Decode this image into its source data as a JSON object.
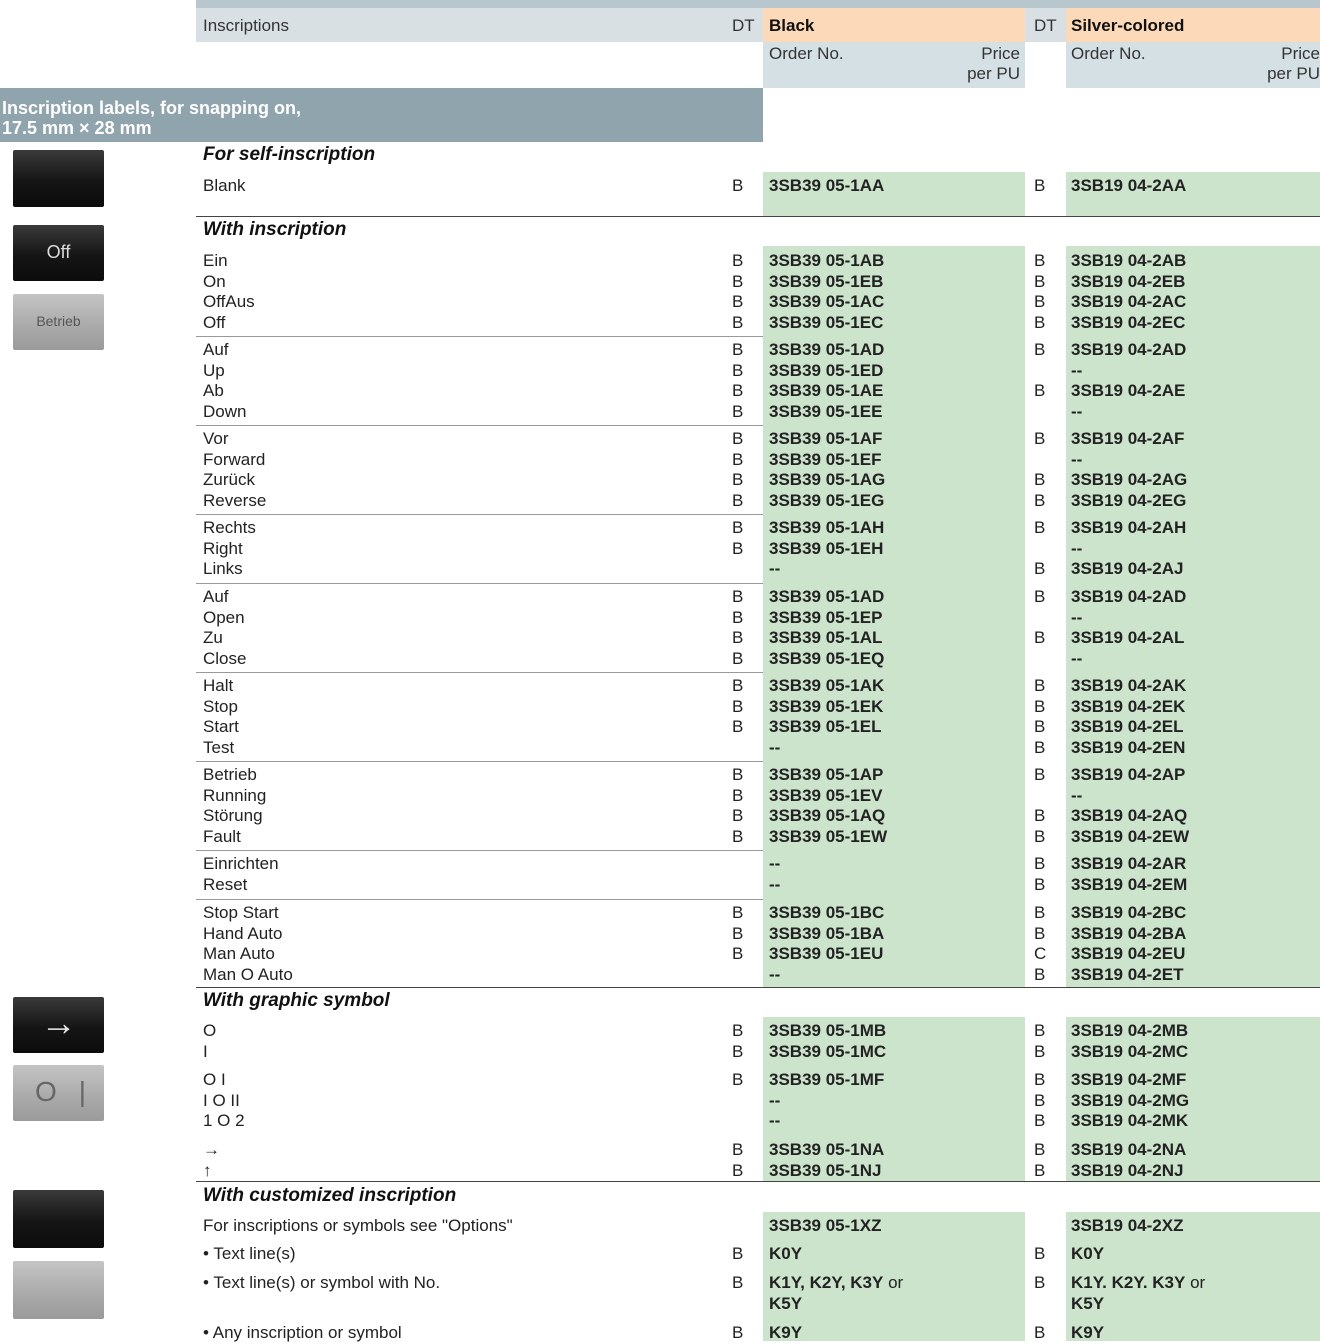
{
  "header": {
    "inscriptions": "Inscriptions",
    "dt": "DT",
    "black": "Black",
    "silver": "Silver-colored",
    "order_no": "Order No.",
    "price": "Price",
    "per_pu": "per PU"
  },
  "section": {
    "line1": "Inscription labels, for snapping on,",
    "line2": "17.5 mm × 28 mm"
  },
  "thumbs": {
    "off": "Off",
    "betrieb": "Betrieb",
    "arrow": "→",
    "o": "O",
    "i": "|"
  },
  "groups": [
    {
      "title": "For self-inscription",
      "rows": [
        {
          "label": "Blank",
          "dt1": "B",
          "black": "3SB39 05-1AA",
          "dt2": "B",
          "silver": "3SB19 04-2AA"
        }
      ]
    },
    {
      "title": "With inscription",
      "rows": [
        {
          "label": "Ein",
          "dt1": "B",
          "black": "3SB39 05-1AB",
          "dt2": "B",
          "silver": "3SB19 04-2AB"
        },
        {
          "label": "On",
          "dt1": "B",
          "black": "3SB39 05-1EB",
          "dt2": "B",
          "silver": "3SB19 04-2EB"
        },
        {
          "label": "OffAus",
          "dt1": "B",
          "black": "3SB39 05-1AC",
          "dt2": "B",
          "silver": "3SB19 04-2AC"
        },
        {
          "label": "Off",
          "dt1": "B",
          "black": "3SB39 05-1EC",
          "dt2": "B",
          "silver": "3SB19 04-2EC"
        },
        {
          "label": "Auf",
          "dt1": "B",
          "black": "3SB39 05-1AD",
          "dt2": "B",
          "silver": "3SB19 04-2AD"
        },
        {
          "label": "Up",
          "dt1": "B",
          "black": "3SB39 05-1ED",
          "dt2": "",
          "silver": "--"
        },
        {
          "label": "Ab",
          "dt1": "B",
          "black": "3SB39 05-1AE",
          "dt2": "B",
          "silver": "3SB19 04-2AE"
        },
        {
          "label": "Down",
          "dt1": "B",
          "black": "3SB39 05-1EE",
          "dt2": "",
          "silver": "--"
        },
        {
          "label": "Vor",
          "dt1": "B",
          "black": "3SB39 05-1AF",
          "dt2": "B",
          "silver": "3SB19 04-2AF"
        },
        {
          "label": "Forward",
          "dt1": "B",
          "black": "3SB39 05-1EF",
          "dt2": "",
          "silver": "--"
        },
        {
          "label": "Zurück",
          "dt1": "B",
          "black": "3SB39 05-1AG",
          "dt2": "B",
          "silver": "3SB19 04-2AG"
        },
        {
          "label": "Reverse",
          "dt1": "B",
          "black": "3SB39 05-1EG",
          "dt2": "B",
          "silver": "3SB19 04-2EG"
        },
        {
          "label": "Rechts",
          "dt1": "B",
          "black": "3SB39 05-1AH",
          "dt2": "B",
          "silver": "3SB19 04-2AH"
        },
        {
          "label": "Right",
          "dt1": "B",
          "black": "3SB39 05-1EH",
          "dt2": "",
          "silver": "--"
        },
        {
          "label": "Links",
          "dt1": "",
          "black": "--",
          "dt2": "B",
          "silver": "3SB19 04-2AJ"
        },
        {
          "label": "Auf",
          "dt1": "B",
          "black": "3SB39 05-1AD",
          "dt2": "B",
          "silver": "3SB19 04-2AD"
        },
        {
          "label": "Open",
          "dt1": "B",
          "black": "3SB39 05-1EP",
          "dt2": "",
          "silver": "--"
        },
        {
          "label": "Zu",
          "dt1": "B",
          "black": "3SB39 05-1AL",
          "dt2": "B",
          "silver": "3SB19 04-2AL"
        },
        {
          "label": "Close",
          "dt1": "B",
          "black": "3SB39 05-1EQ",
          "dt2": "",
          "silver": "--"
        },
        {
          "label": "Halt",
          "dt1": "B",
          "black": "3SB39 05-1AK",
          "dt2": "B",
          "silver": "3SB19 04-2AK"
        },
        {
          "label": "Stop",
          "dt1": "B",
          "black": "3SB39 05-1EK",
          "dt2": "B",
          "silver": "3SB19 04-2EK"
        },
        {
          "label": "Start",
          "dt1": "B",
          "black": "3SB39 05-1EL",
          "dt2": "B",
          "silver": "3SB19 04-2EL"
        },
        {
          "label": "Test",
          "dt1": "",
          "black": "--",
          "dt2": "B",
          "silver": "3SB19 04-2EN"
        },
        {
          "label": "Betrieb",
          "dt1": "B",
          "black": "3SB39 05-1AP",
          "dt2": "B",
          "silver": "3SB19 04-2AP"
        },
        {
          "label": "Running",
          "dt1": "B",
          "black": "3SB39 05-1EV",
          "dt2": "",
          "silver": "--"
        },
        {
          "label": "Störung",
          "dt1": "B",
          "black": "3SB39 05-1AQ",
          "dt2": "B",
          "silver": "3SB19 04-2AQ"
        },
        {
          "label": "Fault",
          "dt1": "B",
          "black": "3SB39 05-1EW",
          "dt2": "B",
          "silver": "3SB19 04-2EW"
        },
        {
          "label": "Einrichten",
          "dt1": "",
          "black": "--",
          "dt2": "B",
          "silver": "3SB19 04-2AR"
        },
        {
          "label": "Reset",
          "dt1": "",
          "black": "--",
          "dt2": "B",
          "silver": "3SB19 04-2EM"
        },
        {
          "label": "Stop Start",
          "dt1": "B",
          "black": "3SB39 05-1BC",
          "dt2": "B",
          "silver": "3SB19 04-2BC"
        },
        {
          "label": "Hand Auto",
          "dt1": "B",
          "black": "3SB39 05-1BA",
          "dt2": "B",
          "silver": "3SB19 04-2BA"
        },
        {
          "label": "Man Auto",
          "dt1": "B",
          "black": "3SB39 05-1EU",
          "dt2": "C",
          "silver": "3SB19 04-2EU"
        },
        {
          "label": "Man O Auto",
          "dt1": "",
          "black": "--",
          "dt2": "B",
          "silver": "3SB19 04-2ET"
        }
      ]
    },
    {
      "title": "With graphic symbol",
      "rows": [
        {
          "label": "O",
          "dt1": "B",
          "black": "3SB39 05-1MB",
          "dt2": "B",
          "silver": "3SB19 04-2MB"
        },
        {
          "label": "I",
          "dt1": "B",
          "black": "3SB39 05-1MC",
          "dt2": "B",
          "silver": "3SB19 04-2MC"
        },
        {
          "label": "O I",
          "dt1": "B",
          "black": "3SB39 05-1MF",
          "dt2": "B",
          "silver": "3SB19 04-2MF"
        },
        {
          "label": "I  O  II",
          "dt1": "",
          "black": "--",
          "dt2": "B",
          "silver": "3SB19 04-2MG"
        },
        {
          "label": "1  O  2",
          "dt1": "",
          "black": "--",
          "dt2": "B",
          "silver": "3SB19 04-2MK"
        },
        {
          "label": "→",
          "dt1": "B",
          "black": "3SB39 05-1NA",
          "dt2": "B",
          "silver": "3SB19 04-2NA"
        },
        {
          "label": "↑",
          "dt1": "B",
          "black": "3SB39 05-1NJ",
          "dt2": "B",
          "silver": "3SB19 04-2NJ"
        }
      ]
    },
    {
      "title": "With customized inscription",
      "rows": [
        {
          "label": "For inscriptions or symbols see \"Options\"",
          "dt1": "",
          "black": "3SB39 05-1XZ",
          "dt2": "",
          "silver": "3SB19 04-2XZ"
        },
        {
          "label": "• Text line(s)",
          "dt1": "B",
          "black": "K0Y",
          "dt2": "B",
          "silver": "K0Y"
        },
        {
          "label": "• Text line(s) or symbol with No.",
          "dt1": "B",
          "black": "K1Y, K2Y, K3Y",
          "black_or": " or",
          "black2": "K5Y",
          "dt2": "B",
          "silver": "K1Y. K2Y. K3Y",
          "silver_or": " or",
          "silver2": "K5Y"
        },
        {
          "label": "• Any inscription or symbol",
          "dt1": "B",
          "black": "K9Y",
          "dt2": "B",
          "silver": "K9Y"
        }
      ]
    }
  ]
}
